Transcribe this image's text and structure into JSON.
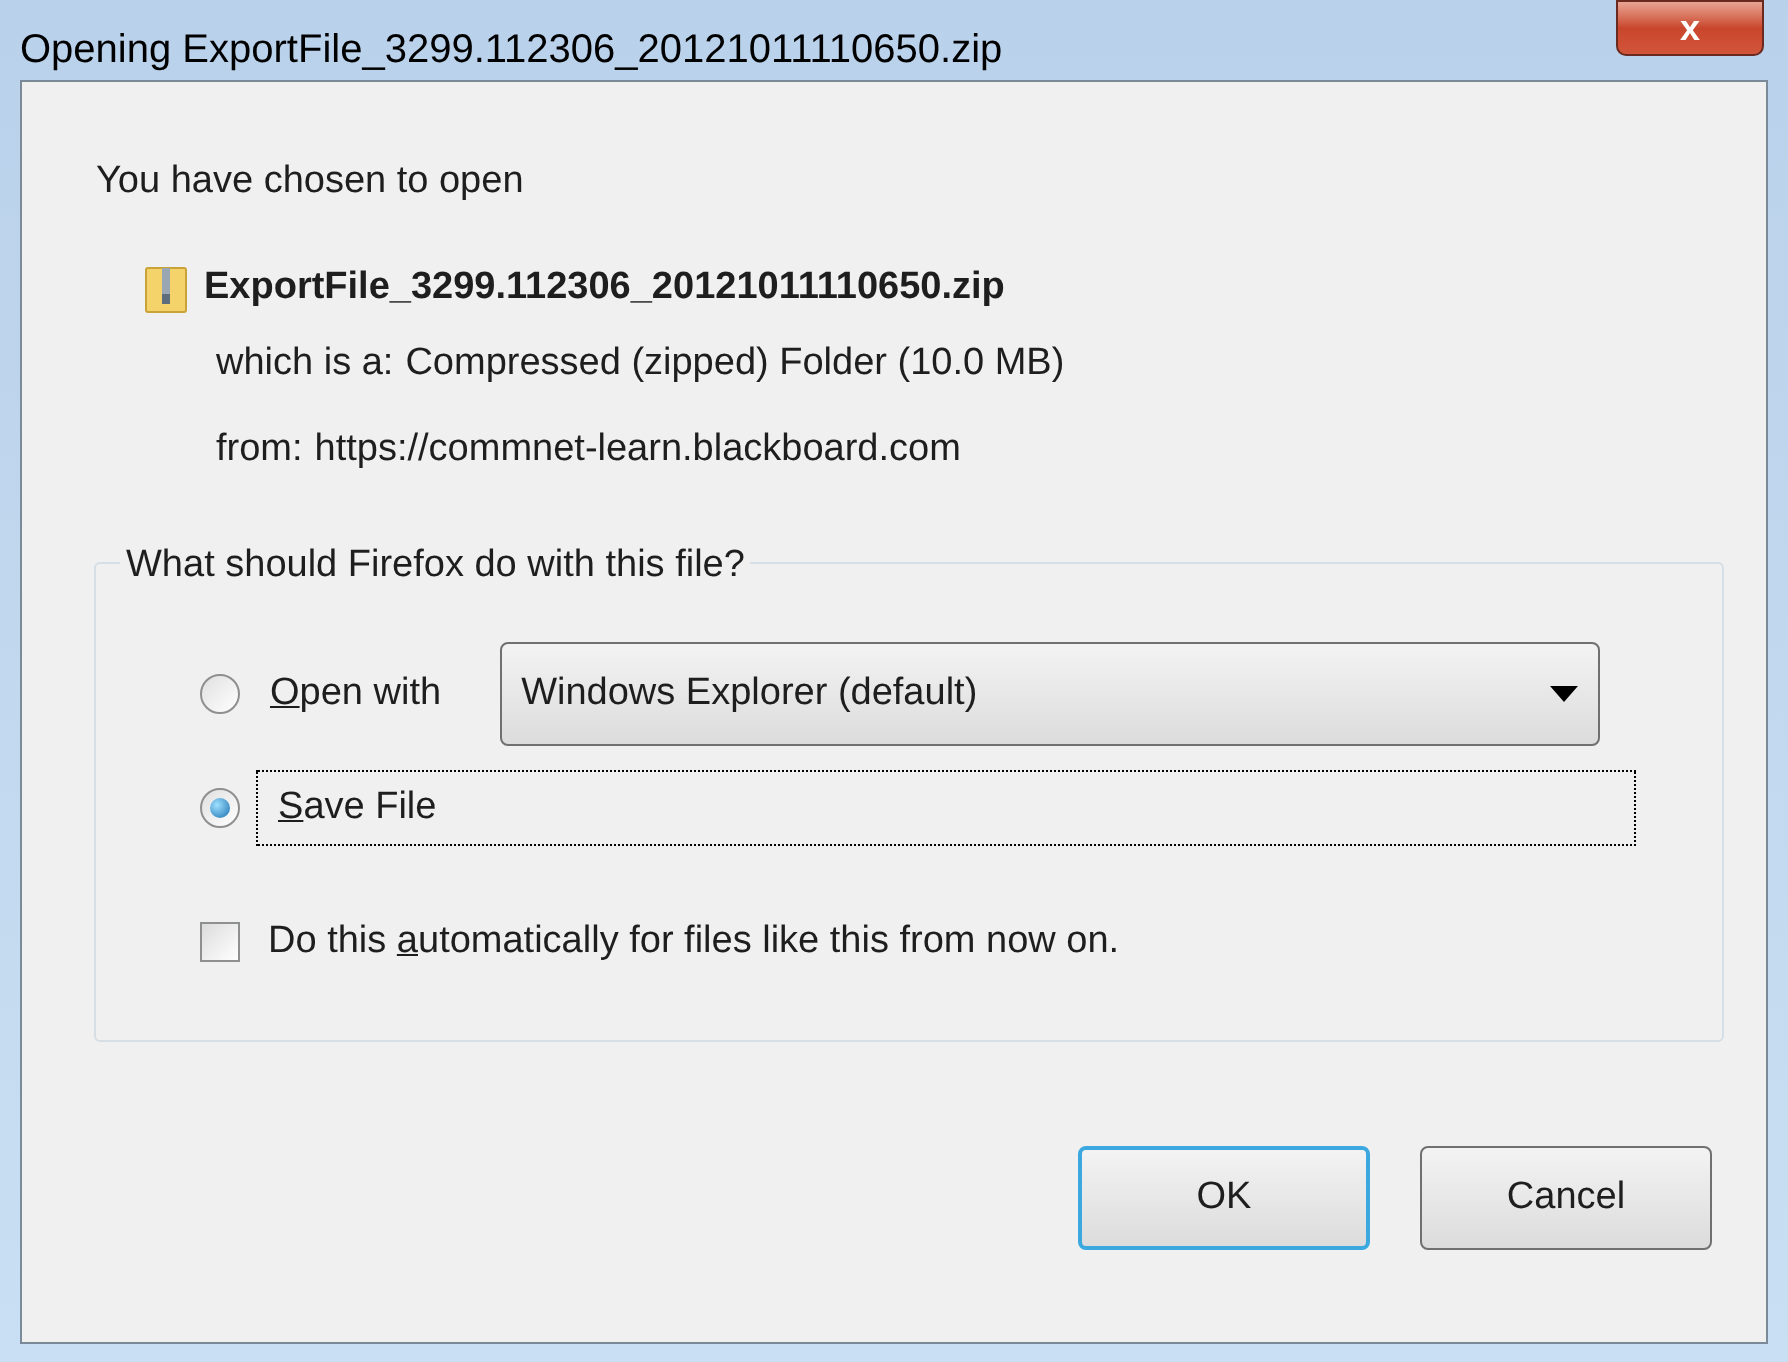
{
  "window": {
    "title": "Opening ExportFile_3299.112306_20121011110650.zip",
    "close": "x"
  },
  "intro": "You have chosen to open",
  "file": {
    "name": "ExportFile_3299.112306_20121011110650.zip",
    "details": [
      {
        "label": "which is a:",
        "value": "Compressed (zipped) Folder (10.0  MB)"
      },
      {
        "label": "from:",
        "value": "https://commnet-learn.blackboard.com"
      }
    ]
  },
  "group": {
    "legend": "What should Firefox do with this file?",
    "options": [
      {
        "kind": "open-with",
        "label": {
          "key": "O",
          "after": "pen with"
        },
        "selected": false,
        "focused": false,
        "app": "Windows Explorer (default)"
      },
      {
        "kind": "save",
        "label": {
          "key": "S",
          "after": "ave File"
        },
        "selected": true,
        "focused": true
      }
    ],
    "remember": {
      "label": {
        "before": "Do this ",
        "key": "a",
        "after": "utomatically for files like this from now on."
      },
      "checked": false
    }
  },
  "buttons": [
    {
      "label": "OK",
      "default": true
    },
    {
      "label": "Cancel",
      "default": false
    }
  ]
}
